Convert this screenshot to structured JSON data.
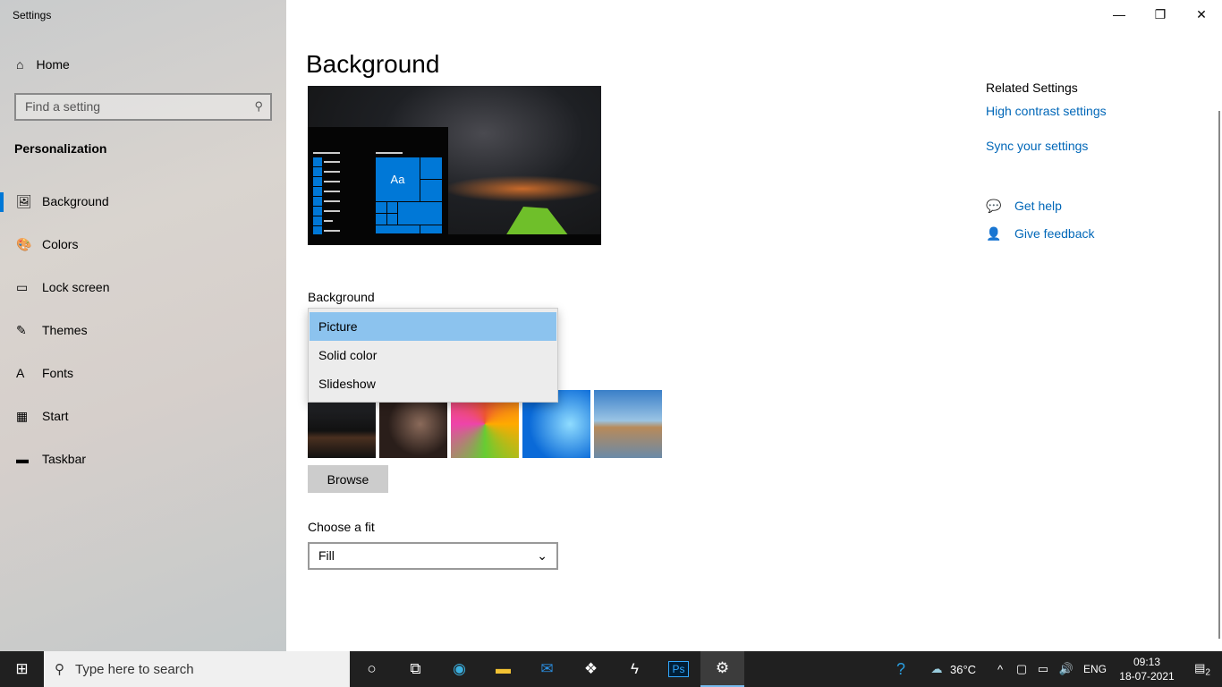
{
  "window": {
    "title": "Settings",
    "minimize": "—",
    "maximize": "❐",
    "close": "✕"
  },
  "sidebar": {
    "home": "Home",
    "search_placeholder": "Find a setting",
    "section": "Personalization",
    "items": [
      {
        "label": "Background",
        "icon": "🖼"
      },
      {
        "label": "Colors",
        "icon": "🎨"
      },
      {
        "label": "Lock screen",
        "icon": "▭"
      },
      {
        "label": "Themes",
        "icon": "✎"
      },
      {
        "label": "Fonts",
        "icon": "A"
      },
      {
        "label": "Start",
        "icon": "▦"
      },
      {
        "label": "Taskbar",
        "icon": "▬"
      }
    ]
  },
  "main": {
    "title": "Background",
    "preview_tile_text": "Aa",
    "background_label": "Background",
    "background_options": [
      "Picture",
      "Solid color",
      "Slideshow"
    ],
    "selected": "Picture",
    "browse": "Browse",
    "fit_label": "Choose a fit",
    "fit_value": "Fill"
  },
  "related": {
    "heading": "Related Settings",
    "links": [
      "High contrast settings",
      "Sync your settings"
    ],
    "help": "Get help",
    "feedback": "Give feedback"
  },
  "taskbar": {
    "search_placeholder": "Type here to search",
    "weather": "36°C",
    "lang": "ENG",
    "time": "09:13",
    "date": "18-07-2021",
    "notifications": "2",
    "accent": "#0078d7"
  }
}
